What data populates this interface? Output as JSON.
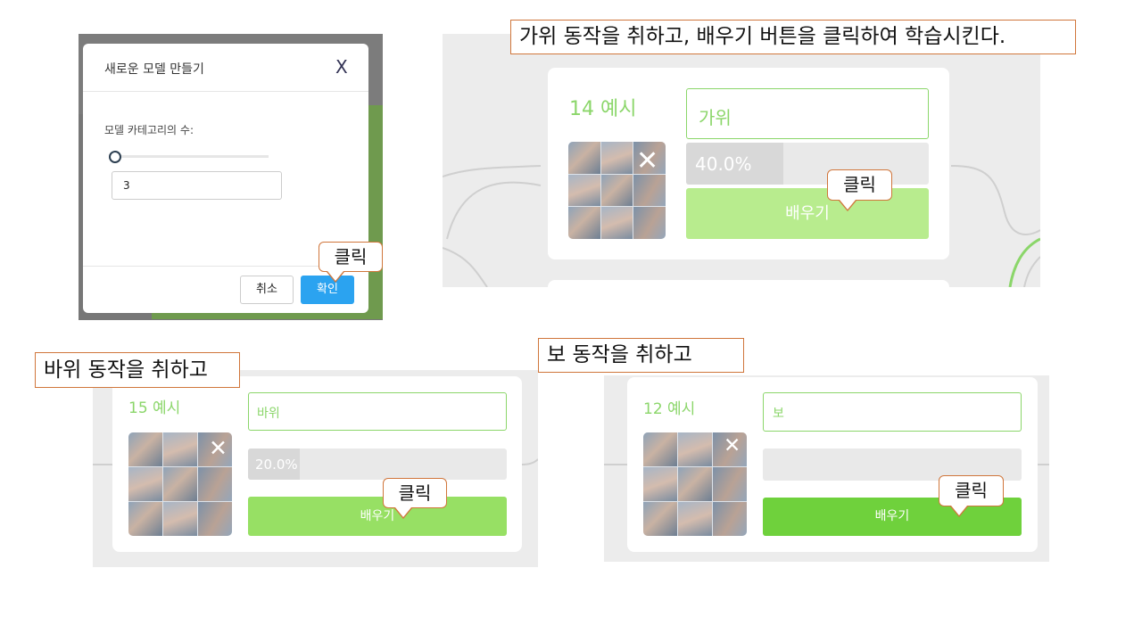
{
  "modal": {
    "title": "새로운 모델 만들기",
    "close_glyph": "X",
    "label": "모델 카테고리의 수:",
    "input_value": "3",
    "cancel_label": "취소",
    "ok_label": "확인",
    "slider_level": 0
  },
  "callouts": {
    "click": "클릭",
    "top_caption": "가위 동작을 취하고, 배우기 버튼을 클릭하여 학습시킨다.",
    "left_caption": "바위 동작을 취하고",
    "right_caption": "보 동작을 취하고"
  },
  "cards": {
    "scissors": {
      "examples": "14 예시",
      "name": "가위",
      "progress_text": "40.0%",
      "progress_fraction": 0.4,
      "train_label": "배우기",
      "button_color": "#b8ec8e"
    },
    "rock": {
      "examples": "15 예시",
      "name": "바위",
      "progress_text": "20.0%",
      "progress_fraction": 0.2,
      "train_label": "배우기",
      "button_color": "#97e064"
    },
    "paper": {
      "examples": "12 예시",
      "name": "보",
      "progress_text": "",
      "progress_fraction": 0,
      "train_label": "배우기",
      "button_color": "#6fd13c"
    }
  },
  "icons": {
    "remove": "close-icon"
  },
  "colors": {
    "accent_green": "#8bd66a",
    "confirm_blue": "#2ba3f0",
    "callout_border": "#d0763b"
  }
}
